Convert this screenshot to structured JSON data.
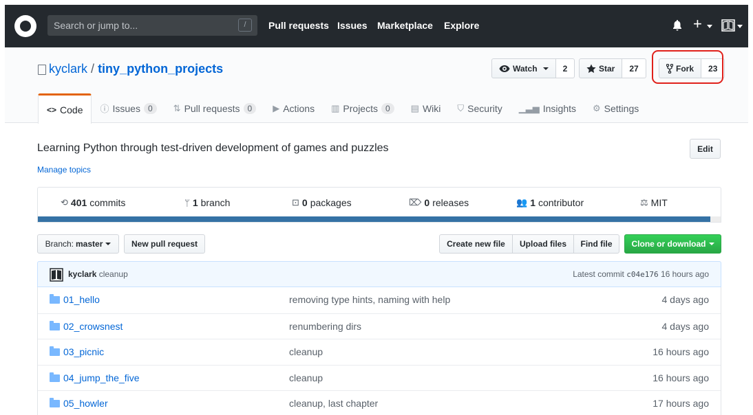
{
  "topnav": {
    "search_placeholder": "Search or jump to...",
    "search_shortcut": "/",
    "links": [
      "Pull requests",
      "Issues",
      "Marketplace",
      "Explore"
    ],
    "plus_label": "+"
  },
  "repo": {
    "owner": "kyclark",
    "separator": "/",
    "name": "tiny_python_projects",
    "watch_label": "Watch",
    "watch_count": "2",
    "star_label": "Star",
    "star_count": "27",
    "fork_label": "Fork",
    "fork_count": "23",
    "highlight_color": "#e0201a"
  },
  "tabs": [
    {
      "label": "Code",
      "icon": "code-icon",
      "selected": true
    },
    {
      "label": "Issues",
      "icon": "issue-icon",
      "counter": "0"
    },
    {
      "label": "Pull requests",
      "icon": "pull-request-icon",
      "counter": "0"
    },
    {
      "label": "Actions",
      "icon": "play-icon"
    },
    {
      "label": "Projects",
      "icon": "project-icon",
      "counter": "0"
    },
    {
      "label": "Wiki",
      "icon": "book-icon"
    },
    {
      "label": "Security",
      "icon": "shield-icon"
    },
    {
      "label": "Insights",
      "icon": "graph-icon"
    },
    {
      "label": "Settings",
      "icon": "gear-icon"
    }
  ],
  "about": {
    "description": "Learning Python through test-driven development of games and puzzles",
    "manage_topics": "Manage topics",
    "edit_label": "Edit"
  },
  "summary": {
    "commits_count": "401",
    "commits_label": "commits",
    "branch_count": "1",
    "branch_label": "branch",
    "packages_count": "0",
    "packages_label": "packages",
    "releases_count": "0",
    "releases_label": "releases",
    "contributor_count": "1",
    "contributor_label": "contributor",
    "license": "MIT",
    "language_color": "#3572a5"
  },
  "filenav": {
    "branch_prefix": "Branch:",
    "branch_name": "master",
    "new_pr": "New pull request",
    "create_file": "Create new file",
    "upload_files": "Upload files",
    "find_file": "Find file",
    "clone": "Clone or download"
  },
  "commit": {
    "author": "kyclark",
    "message": "cleanup",
    "latest_label": "Latest commit",
    "sha": "c04e176",
    "age": "16 hours ago"
  },
  "files": [
    {
      "name": "01_hello",
      "message": "removing type hints, naming with help",
      "age": "4 days ago"
    },
    {
      "name": "02_crowsnest",
      "message": "renumbering dirs",
      "age": "4 days ago"
    },
    {
      "name": "03_picnic",
      "message": "cleanup",
      "age": "16 hours ago"
    },
    {
      "name": "04_jump_the_five",
      "message": "cleanup",
      "age": "16 hours ago"
    },
    {
      "name": "05_howler",
      "message": "cleanup, last chapter",
      "age": "17 hours ago"
    }
  ]
}
